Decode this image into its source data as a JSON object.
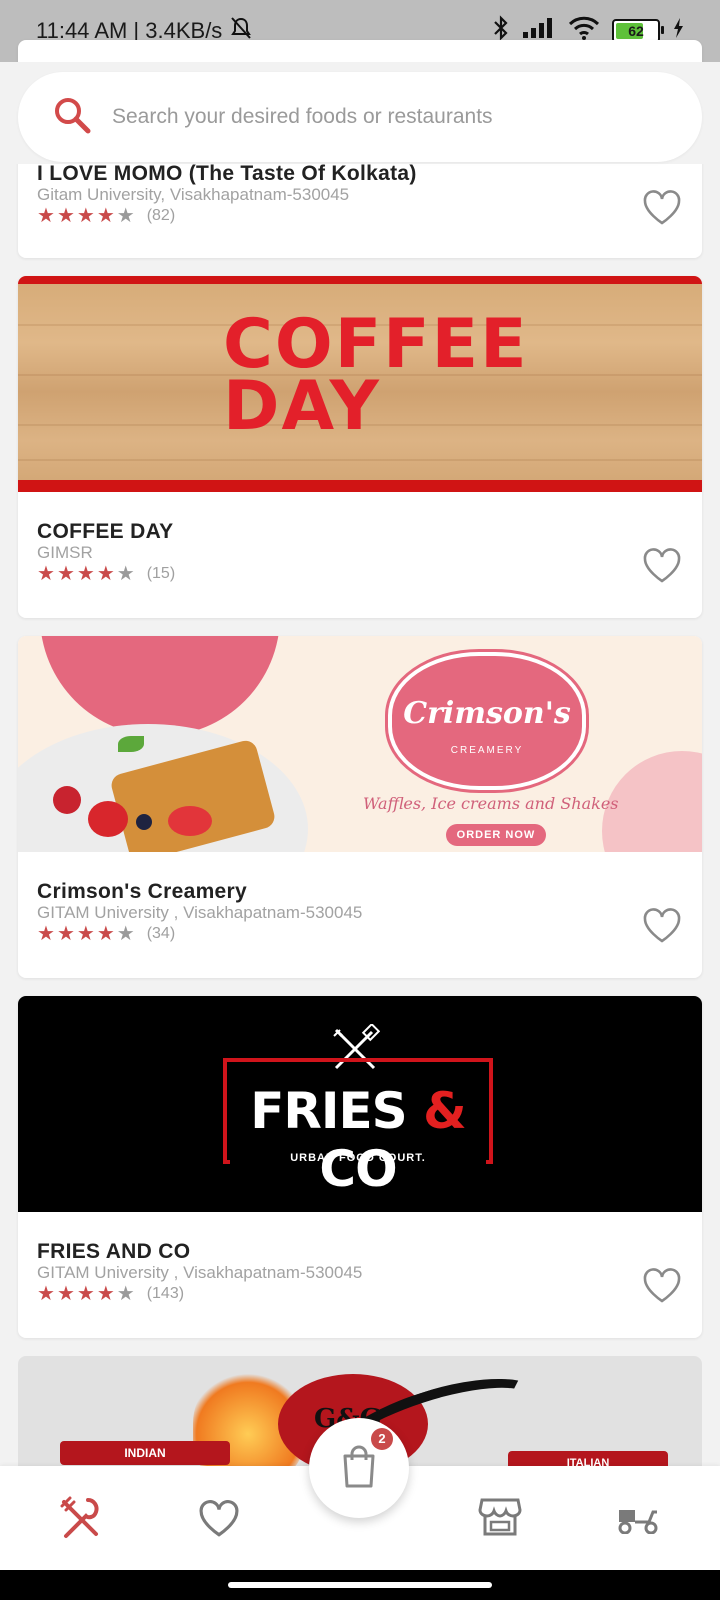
{
  "status_bar": {
    "time_speed": "11:44 AM | 3.4KB/s",
    "battery": "62"
  },
  "search": {
    "placeholder": "Search your desired foods or restaurants"
  },
  "restaurants": [
    {
      "name": "I LOVE MOMO (The Taste Of Kolkata)",
      "address": "Gitam University, Visakhapatnam-530045",
      "rating": 4,
      "reviews": "(82)"
    },
    {
      "name": "COFFEE DAY",
      "address": "GIMSR",
      "rating": 4,
      "reviews": "(15)",
      "banner": {
        "line1": "COFFEE",
        "line2": "DAY"
      }
    },
    {
      "name": "Crimson's Creamery",
      "address": "GITAM University , Visakhapatnam-530045",
      "rating": 4,
      "reviews": "(34)",
      "banner": {
        "title": "Crimson's",
        "subtitle": "CREAMERY",
        "tagline": "Waffles, Ice creams and Shakes",
        "cta": "ORDER NOW"
      }
    },
    {
      "name": "FRIES AND CO",
      "address": "GITAM University , Visakhapatnam-530045",
      "rating": 4,
      "reviews": "(143)",
      "banner": {
        "word1": "FRIES",
        "amp": "&",
        "word2": "CO",
        "subtitle": "URBAN FOOD COURT."
      }
    },
    {
      "banner": {
        "logo": "G&G",
        "tag_left": "INDIAN",
        "tag_right": "ITALIAN"
      }
    }
  ],
  "cart": {
    "count": "2"
  },
  "colors": {
    "accent": "#c94a4a",
    "coffee_red": "#e3202a",
    "crimson_pink": "#e4687e"
  },
  "nav": [
    "restaurants-icon",
    "favorites-icon",
    "cart-icon",
    "stores-icon",
    "delivery-icon"
  ]
}
